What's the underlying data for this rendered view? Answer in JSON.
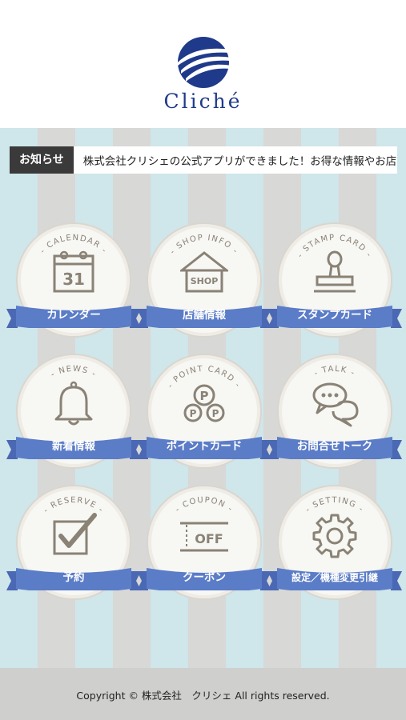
{
  "brand": {
    "name": "Cliché"
  },
  "news": {
    "tag": "お知らせ",
    "text": "株式会社クリシェの公式アプリができました！お得な情報やお店が"
  },
  "tiles": [
    {
      "arc": "- CALENDAR -",
      "label": "カレンダー",
      "icon": "calendar-icon",
      "icon_text": "31"
    },
    {
      "arc": "- SHOP INFO -",
      "label": "店舗情報",
      "icon": "shop-icon",
      "icon_text": "SHOP"
    },
    {
      "arc": "- STAMP CARD -",
      "label": "スタンプカード",
      "icon": "stamp-icon"
    },
    {
      "arc": "- NEWS -",
      "label": "新着情報",
      "icon": "bell-icon"
    },
    {
      "arc": "- POINT CARD -",
      "label": "ポイントカード",
      "icon": "point-coins-icon",
      "icon_text": "P"
    },
    {
      "arc": "- TALK -",
      "label": "お問合せトーク",
      "icon": "chat-bubbles-icon"
    },
    {
      "arc": "- RESERVE -",
      "label": "予約",
      "icon": "checkbox-icon"
    },
    {
      "arc": "- COUPON -",
      "label": "クーポン",
      "icon": "coupon-icon",
      "icon_text": "OFF"
    },
    {
      "arc": "- SETTING -",
      "label": "設定／機種変更引継",
      "icon": "gear-icon"
    }
  ],
  "footer": {
    "copyright": "Copyright © 株式会社　クリシェ All rights reserved."
  },
  "colors": {
    "brand_blue": "#1f3a8a",
    "ribbon_blue": "#5b7cc7",
    "icon_stroke": "#8a8275"
  }
}
